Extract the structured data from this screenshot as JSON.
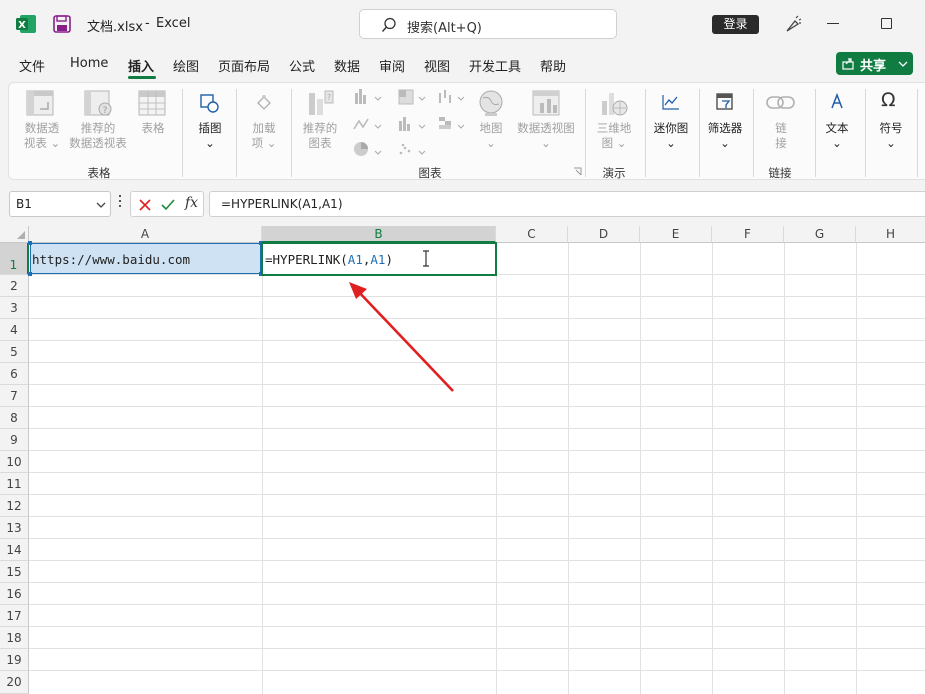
{
  "window": {
    "filename": "文档.xlsx",
    "separator": "-",
    "app_name": "Excel",
    "search_placeholder": "搜索(Alt+Q)",
    "login_label": "登录",
    "share_label": "共享"
  },
  "menu": {
    "tabs": [
      "文件",
      "Home",
      "插入",
      "绘图",
      "页面布局",
      "公式",
      "数据",
      "审阅",
      "视图",
      "开发工具",
      "帮助"
    ],
    "active_tab": "插入"
  },
  "ribbon": {
    "groups": {
      "tables": "表格",
      "charts": "图表",
      "tours": "演示",
      "links": "链接"
    },
    "buttons": {
      "pivot_table": [
        "数据透",
        "视表"
      ],
      "recommended_pivot": [
        "推荐的",
        "数据透视表"
      ],
      "table": "表格",
      "illustrations": "插图",
      "addins": [
        "加载",
        "项"
      ],
      "recommended_charts": [
        "推荐的",
        "图表"
      ],
      "maps": "地图",
      "pivot_chart": "数据透视图",
      "3d_map": [
        "三维地",
        "图"
      ],
      "sparklines": "迷你图",
      "filters": "筛选器",
      "link": [
        "链",
        "接"
      ],
      "text": "文本",
      "symbols": "符号"
    }
  },
  "formula_bar": {
    "name_box": "B1",
    "fx": "fx",
    "formula": "=HYPERLINK(A1,A1)"
  },
  "sheet": {
    "columns": [
      "A",
      "B",
      "C",
      "D",
      "E",
      "F",
      "G",
      "H"
    ],
    "rows": [
      "1",
      "2",
      "3",
      "4",
      "5",
      "6",
      "7",
      "8",
      "9",
      "10",
      "11",
      "12",
      "13",
      "14",
      "15",
      "16",
      "17",
      "18",
      "19",
      "20"
    ],
    "cells": {
      "A1": "https://www.baidu.com",
      "B1_prefix": "=HYPERLINK(",
      "B1_ref1": "A1",
      "B1_comma": ",",
      "B1_ref2": "A1",
      "B1_suffix": ")"
    }
  },
  "colors": {
    "excel_green": "#107c41",
    "selection_blue": "#cfe2f3",
    "arrow_red": "#e02020",
    "ref_blue": "#1f6fb2"
  }
}
